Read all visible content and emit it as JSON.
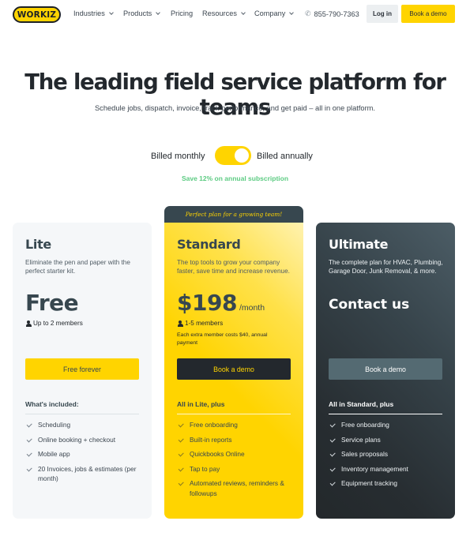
{
  "nav": {
    "logo": "WORKIZ",
    "items": [
      {
        "label": "Industries",
        "has_dropdown": true
      },
      {
        "label": "Products",
        "has_dropdown": true
      },
      {
        "label": "Pricing",
        "has_dropdown": false
      },
      {
        "label": "Resources",
        "has_dropdown": true
      },
      {
        "label": "Company",
        "has_dropdown": true
      }
    ],
    "phone": "855-790-7363",
    "phone_icon": "phone-icon",
    "login_label": "Log in",
    "demo_label": "Book a demo"
  },
  "hero": {
    "title": "The leading field service platform for teams",
    "subtitle": "Schedule jobs, dispatch, invoice, track performance, and get paid – all in one platform."
  },
  "billing": {
    "monthly_label": "Billed monthly",
    "annual_label": "Billed annually",
    "annual_selected": true,
    "save_note": "Save 12% on annual subscription"
  },
  "colors": {
    "brand_yellow": "#ffd400",
    "dark": "#23282d",
    "slate": "#37474f",
    "save_green": "#5ccb82"
  },
  "plans": [
    {
      "name": "Lite",
      "description": "Eliminate the pen and paper with the perfect starter kit.",
      "price": "Free",
      "members": "Up to 2 members",
      "cta": "Free forever",
      "included_heading": "What's included:",
      "features": [
        "Scheduling",
        "Online booking + checkout",
        "Mobile app",
        "20 Invoices, jobs & estimates (per month)"
      ]
    },
    {
      "banner": "Perfect plan for a growing team!",
      "name": "Standard",
      "description": "The top tools to grow your company faster, save time and increase revenue.",
      "price": "$198",
      "price_unit": "/month",
      "members": "1-5 members",
      "extra_note": "Each extra member costs $40, annual payment",
      "cta": "Book a demo",
      "included_heading": "All in Lite, plus",
      "features": [
        "Free onboarding",
        "Built-in reports",
        "Quickbooks Online",
        "Tap to pay",
        "Automated reviews, reminders & followups"
      ]
    },
    {
      "name": "Ultimate",
      "description": "The complete plan for HVAC, Plumbing, Garage Door, Junk Removal, & more.",
      "price": "Contact us",
      "cta": "Book a demo",
      "included_heading": "All in Standard, plus",
      "features": [
        "Free onboarding",
        "Service plans",
        "Sales proposals",
        "Inventory management",
        "Equipment tracking"
      ]
    }
  ]
}
